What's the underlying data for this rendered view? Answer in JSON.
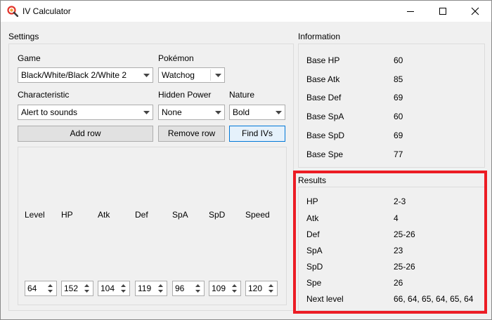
{
  "window": {
    "title": "IV Calculator"
  },
  "settings": {
    "group_title": "Settings",
    "game_label": "Game",
    "game_value": "Black/White/Black 2/White 2",
    "pokemon_label": "Pokémon",
    "pokemon_value": "Watchog",
    "characteristic_label": "Characteristic",
    "characteristic_value": "Alert to sounds",
    "hidden_power_label": "Hidden Power",
    "hidden_power_value": "None",
    "nature_label": "Nature",
    "nature_value": "Bold",
    "add_row_label": "Add row",
    "remove_row_label": "Remove row",
    "find_ivs_label": "Find IVs"
  },
  "stats_table": {
    "headers": [
      "Level",
      "HP",
      "Atk",
      "Def",
      "SpA",
      "SpD",
      "Speed"
    ],
    "values": [
      "64",
      "152",
      "104",
      "119",
      "96",
      "109",
      "120"
    ]
  },
  "information": {
    "group_title": "Information",
    "rows": [
      {
        "label": "Base HP",
        "value": "60"
      },
      {
        "label": "Base Atk",
        "value": "85"
      },
      {
        "label": "Base Def",
        "value": "69"
      },
      {
        "label": "Base SpA",
        "value": "60"
      },
      {
        "label": "Base SpD",
        "value": "69"
      },
      {
        "label": "Base Spe",
        "value": "77"
      }
    ]
  },
  "results": {
    "group_title": "Results",
    "rows": [
      {
        "label": "HP",
        "value": "2-3"
      },
      {
        "label": "Atk",
        "value": "4"
      },
      {
        "label": "Def",
        "value": "25-26"
      },
      {
        "label": "SpA",
        "value": "23"
      },
      {
        "label": "SpD",
        "value": "25-26"
      },
      {
        "label": "Spe",
        "value": "26"
      },
      {
        "label": "Next level",
        "value": "66, 64, 65, 64, 65, 64"
      }
    ]
  },
  "colors": {
    "highlight": "#ec1c24",
    "focus_border": "#0078d7"
  }
}
